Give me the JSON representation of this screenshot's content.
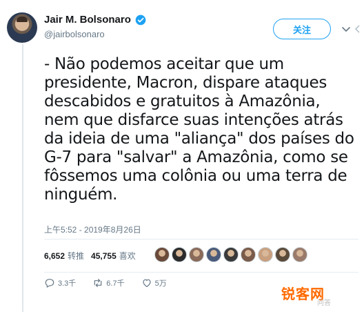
{
  "tweet": {
    "display_name": "Jair M. Bolsonaro",
    "handle": "@jairbolsonaro",
    "follow_label": "关注",
    "text": "- Não podemos aceitar que um presidente, Macron, dispare ataques descabidos e gratuitos à Amazônia, nem que disfarce suas intenções atrás da ideia de uma \"aliança\" dos países do G-7 para \"salvar\" a Amazônia, como se fôssemos uma colônia ou uma terra de ninguém.",
    "timestamp": "上午5:52 - 2019年8月26日",
    "retweets_count": "6,652",
    "retweets_label": "转推",
    "likes_count": "45,755",
    "likes_label": "喜欢",
    "replies_action": "3.3千",
    "retweets_action": "6.7千",
    "likes_action": "5万"
  },
  "likers": [
    "#6b4a3a",
    "#2b2b2b",
    "#8a6a5a",
    "#4a5a7a",
    "#3a3a3a",
    "#7a5a4a",
    "#c8a080",
    "#5a4a3a",
    "#9a7a6a"
  ],
  "watermark": {
    "main": "锐客网",
    "sub": "问答"
  },
  "colors": {
    "accent": "#1da1f2",
    "muted": "#657786",
    "text": "#14171a"
  }
}
